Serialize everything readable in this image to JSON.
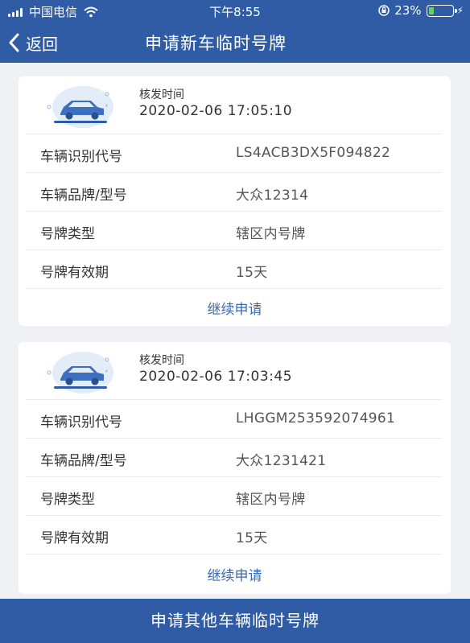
{
  "status_bar": {
    "carrier": "中国电信",
    "time": "下午8:55",
    "battery": "23%",
    "battery_level": 0.23
  },
  "nav": {
    "back_label": "返回",
    "title": "申请新车临时号牌"
  },
  "cards": [
    {
      "issue_label": "核发时间",
      "issue_time": "2020-02-06 17:05:10",
      "rows": [
        {
          "label": "车辆识别代号",
          "value": "LS4ACB3DX5F094822"
        },
        {
          "label": "车辆品牌/型号",
          "value": "大众12314"
        },
        {
          "label": "号牌类型",
          "value": "辖区内号牌"
        },
        {
          "label": "号牌有效期",
          "value": "15天"
        }
      ],
      "continue_label": "继续申请"
    },
    {
      "issue_label": "核发时间",
      "issue_time": "2020-02-06 17:03:45",
      "rows": [
        {
          "label": "车辆识别代号",
          "value": "LHGGM253592074961"
        },
        {
          "label": "车辆品牌/型号",
          "value": "大众1231421"
        },
        {
          "label": "号牌类型",
          "value": "辖区内号牌"
        },
        {
          "label": "号牌有效期",
          "value": "15天"
        }
      ],
      "continue_label": "继续申请"
    }
  ],
  "bottom_button": "申请其他车辆临时号牌",
  "colors": {
    "brand_blue": "#2f5ca4",
    "link_blue": "#3a69b6",
    "battery_green": "#5ed65e",
    "background": "#eff1f5"
  },
  "icons": [
    "signal-icon",
    "wifi-icon",
    "lock-icon",
    "battery-icon",
    "bolt-icon",
    "back-chevron-icon",
    "car-icon"
  ]
}
